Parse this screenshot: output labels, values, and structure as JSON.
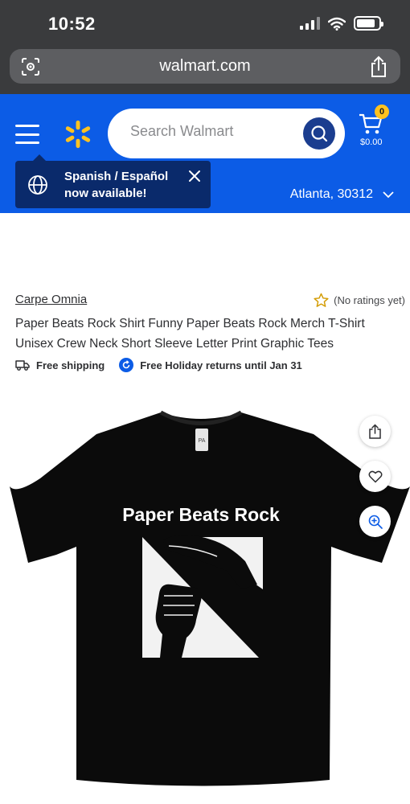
{
  "status_bar": {
    "time": "10:52"
  },
  "browser": {
    "url": "walmart.com"
  },
  "header": {
    "search_placeholder": "Search Walmart",
    "cart": {
      "count": "0",
      "total": "$0.00"
    },
    "language_popup": {
      "line1": "Spanish / Español",
      "line2": "now available!"
    },
    "location": "Atlanta, 30312"
  },
  "product": {
    "brand": "Carpe Omnia",
    "rating_text": "(No ratings yet)",
    "title": "Paper Beats Rock Shirt Funny Paper Beats Rock Merch T-Shirt Unisex Crew Neck Short Sleeve Letter Print Graphic Tees",
    "badges": {
      "shipping": "Free shipping",
      "returns": "Free Holiday returns until Jan 31"
    },
    "image_text": "Paper Beats Rock",
    "image_tag": "PA"
  },
  "icons": {
    "camera": "camera-search-icon",
    "share": "share-icon",
    "menu": "menu-icon",
    "logo": "walmart-spark-logo",
    "search": "search-icon",
    "cart": "cart-icon",
    "globe": "globe-icon",
    "close": "close-icon",
    "chevron": "chevron-down-icon",
    "star": "star-outline-icon",
    "truck": "truck-icon",
    "return": "return-icon",
    "heart": "heart-icon",
    "zoom": "zoom-in-icon"
  },
  "colors": {
    "brand_blue": "#0c5ce6",
    "spark_yellow": "#ffc220",
    "popup_navy": "#0a2a6b",
    "search_button": "#1b3d8f"
  }
}
